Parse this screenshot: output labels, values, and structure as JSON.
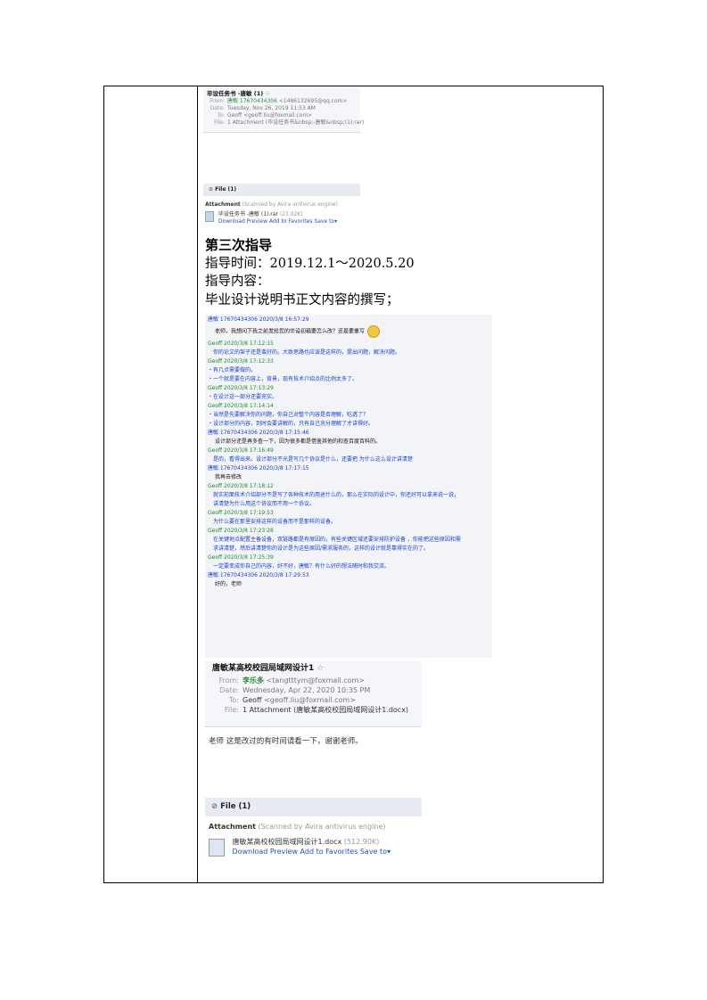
{
  "card1": {
    "subject": "毕设任务书 -唐敏 (1)",
    "star": "☆",
    "from_label": "From:",
    "from_name": "唐敏 17670434306",
    "from_email": "<1486132695@qq.com>",
    "date_label": "Date:",
    "date": "Tuesday, Nov 26, 2019 11:53 AM",
    "to_label": "To:",
    "to_name": "Geoff",
    "to_email": "<geoff.liu@foxmail.com>",
    "file_label": "File:",
    "file_value": "1 Attachment (毕设任务书&nbsp;-唐敏&nbsp;(1).rar)"
  },
  "file_section1": {
    "title": "File (1)",
    "attachment_label": "Attachment",
    "scan_note": "(Scanned by Avira antivirus engine)",
    "filename": "毕设任务书 -唐敏 (1).rar",
    "size": "(27.02K)",
    "actions": [
      "Download",
      "Preview",
      "Add to Favorites",
      "Save to"
    ]
  },
  "doc": {
    "heading": "第三次指导",
    "line1": "指导时间：2019.12.1～2020.5.20",
    "line2": "指导内容：",
    "line3": "毕业设计说明书正文内容的撰写；"
  },
  "chat": [
    {
      "type": "hdr-s",
      "text": "唐敏 17670434306 2020/3/8 16:57:29"
    },
    {
      "type": "msg-black",
      "text": "老师，我想问下我之前发给您的毕设初稿要怎么改？还是要重写"
    },
    {
      "type": "hdr-g",
      "text": "Geoff 2020/3/8 17:12:15"
    },
    {
      "type": "msg-blue",
      "text": "你的论文的架子还是蛮好的。大致思路也应该是这样的，提出问题，解决问题。"
    },
    {
      "type": "hdr-g",
      "text": "Geoff 2020/3/8 17:12:33"
    },
    {
      "type": "msg-blue",
      "text": "・有几点需要做的。"
    },
    {
      "type": "msg-blue",
      "text": "・一个就是要在内容上，背景，现有技术介绍点的比例太多了。"
    },
    {
      "type": "hdr-g",
      "text": "Geoff 2020/3/8 17:13:29"
    },
    {
      "type": "msg-blue",
      "text": "・在设计这一部分还要充实。"
    },
    {
      "type": "hdr-g",
      "text": "Geoff 2020/3/8 17:14:14"
    },
    {
      "type": "msg-blue",
      "text": "・当然是先要解决你的问题，你自己对整个内容是否理解，吃透了？"
    },
    {
      "type": "msg-blue",
      "text": "・设计部分的内容，到时会要讲解的，只有自己充分理解了才讲得好。"
    },
    {
      "type": "hdr-s",
      "text": "唐敏 17670434306 2020/3/8 17:15:46"
    },
    {
      "type": "msg-black",
      "text": "设计部分还是再多查一下，因为很多都是借鉴其他的和查百度百科的。"
    },
    {
      "type": "hdr-g",
      "text": "Geoff 2020/3/8 17:16:49"
    },
    {
      "type": "msg-blue",
      "text": "是的，看得出来。设计部分不光是写几个协议是什么，还要把 为什么这么设计讲清楚"
    },
    {
      "type": "hdr-s",
      "text": "唐敏 17670434306 2020/3/8 17:17:15"
    },
    {
      "type": "msg-black",
      "text": "我再去修改"
    },
    {
      "type": "hdr-g",
      "text": "Geoff 2020/3/8 17:18:12"
    },
    {
      "type": "msg-blue",
      "text": "就实前面技术介绍部分不是写了各种技术的用途什么的，那么在实际的设计中，你还好可以拿来说一说，"
    },
    {
      "type": "msg-blue",
      "text": "讲清楚为什么用这个协议而不用一个协议。"
    },
    {
      "type": "hdr-g",
      "text": "Geoff 2020/3/8 17:19:53"
    },
    {
      "type": "msg-blue",
      "text": "为什么要在那里安排这样的设备而不是那样的设备。"
    },
    {
      "type": "hdr-g",
      "text": "Geoff 2020/3/8 17:23:28"
    },
    {
      "type": "msg-blue",
      "text": "在关键地点配置主备设备，双链路都是有原因的，有些关键区域还要安排防护设备 ，你能把这些原因和需"
    },
    {
      "type": "msg-blue",
      "text": "求讲清楚，然后讲清楚你的设计是为这些原因/需求服务的，这样的设计就是靠得实在的了。"
    },
    {
      "type": "hdr-g",
      "text": "Geoff 2020/3/8 17:25:39"
    },
    {
      "type": "msg-blue",
      "text": "一定要变成你自己的内容，好不好，唐敏？有什么好的想法随时和我交流。"
    },
    {
      "type": "hdr-s",
      "text": "唐敏 17670434306 2020/3/8 17:29:53"
    },
    {
      "type": "msg-black",
      "text": "好的，老师"
    }
  ],
  "card2": {
    "subject": "唐敏某高校校园局域网设计1",
    "star": "☆",
    "from_label": "From:",
    "from_name": "李乐多",
    "from_email": "<tangtttym@foxmail.com>",
    "date_label": "Date:",
    "date": "Wednesday, Apr 22, 2020 10:35 PM",
    "to_label": "To:",
    "to_name": "Geoff",
    "to_email": "<geoff.liu@foxmail.com>",
    "file_label": "File:",
    "file_value": "1 Attachment (唐敏某高校校园局域网设计1.docx)"
  },
  "note": "老师 这是改过的有时间请看一下，谢谢老师。",
  "file_section2": {
    "title": "File (1)",
    "attachment_label": "Attachment",
    "scan_note": "(Scanned by Avira antivirus engine)",
    "filename": "唐敏某高校校园局域网设计1.docx",
    "size": "(512.90K)",
    "actions": [
      "Download",
      "Preview",
      "Add to Favorites",
      "Save to"
    ]
  }
}
